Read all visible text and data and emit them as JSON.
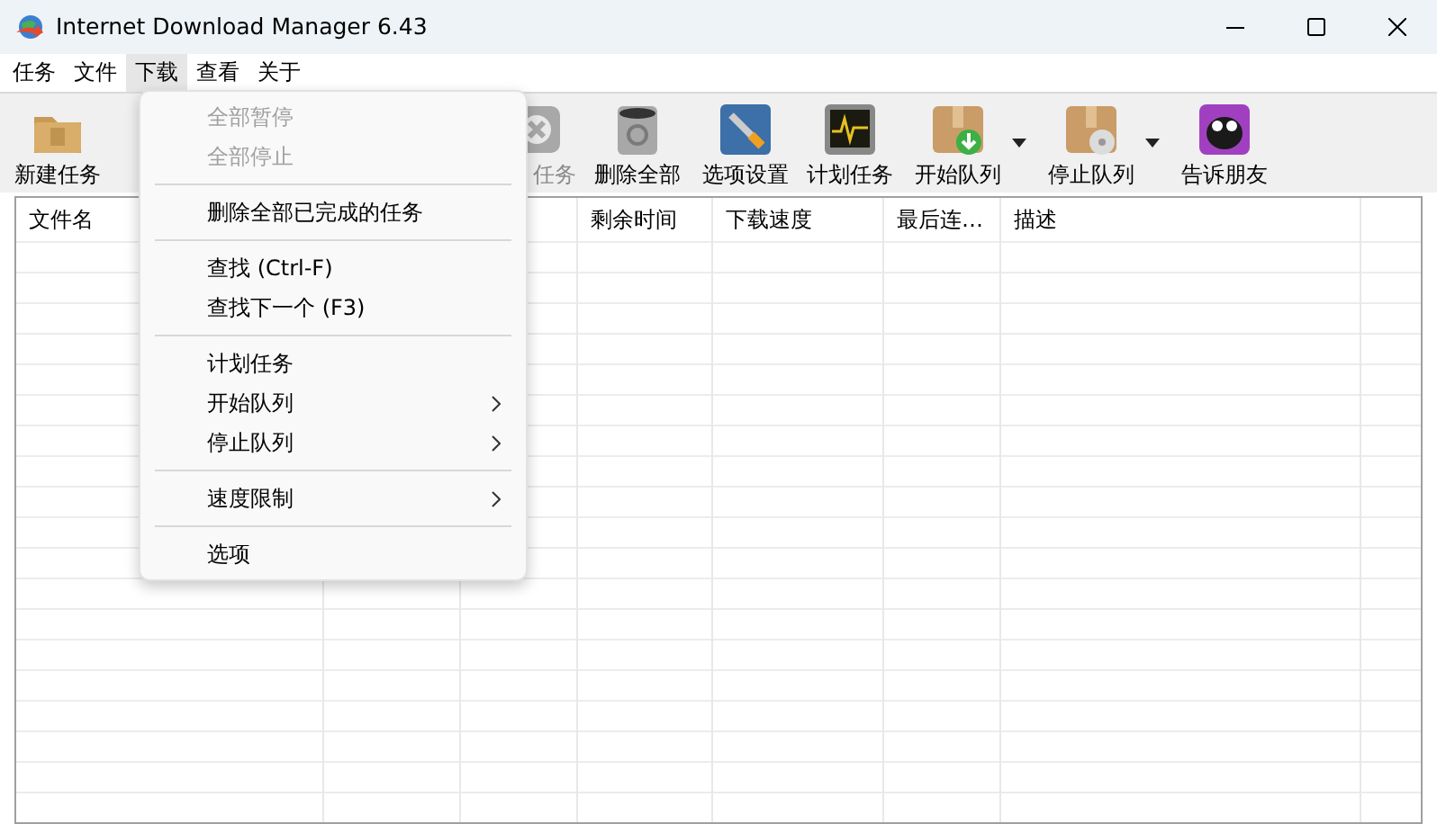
{
  "window": {
    "title": "Internet Download Manager 6.43"
  },
  "menubar": [
    {
      "label": "任务",
      "selected": false
    },
    {
      "label": "文件",
      "selected": false
    },
    {
      "label": "下载",
      "selected": true
    },
    {
      "label": "查看",
      "selected": false
    },
    {
      "label": "关于",
      "selected": false
    }
  ],
  "toolbar": [
    {
      "label": "新建任务",
      "disabled": false,
      "dropdown": false
    },
    {
      "label": "任务",
      "disabled": true,
      "dropdown": false
    },
    {
      "label": "删除全部",
      "disabled": false,
      "dropdown": false
    },
    {
      "label": "选项设置",
      "disabled": false,
      "dropdown": false
    },
    {
      "label": "计划任务",
      "disabled": false,
      "dropdown": false
    },
    {
      "label": "开始队列",
      "disabled": false,
      "dropdown": true
    },
    {
      "label": "停止队列",
      "disabled": false,
      "dropdown": true
    },
    {
      "label": "告诉朋友",
      "disabled": false,
      "dropdown": false
    }
  ],
  "table": {
    "columns": [
      {
        "label": "文件名"
      },
      {},
      {},
      {
        "label": "剩余时间"
      },
      {
        "label": "下载速度"
      },
      {
        "label": "最后连…"
      },
      {
        "label": "描述"
      },
      {}
    ]
  },
  "menu": {
    "items": [
      {
        "kind": "item",
        "label": "全部暂停",
        "disabled": true,
        "submenu": false
      },
      {
        "kind": "item",
        "label": "全部停止",
        "disabled": true,
        "submenu": false
      },
      {
        "kind": "separator"
      },
      {
        "kind": "item",
        "label": "删除全部已完成的任务",
        "disabled": false,
        "submenu": false
      },
      {
        "kind": "separator"
      },
      {
        "kind": "item",
        "label": "查找 (Ctrl-F)",
        "disabled": false,
        "submenu": false
      },
      {
        "kind": "item",
        "label": "查找下一个 (F3)",
        "disabled": false,
        "submenu": false
      },
      {
        "kind": "separator"
      },
      {
        "kind": "item",
        "label": "计划任务",
        "disabled": false,
        "submenu": false
      },
      {
        "kind": "item",
        "label": "开始队列",
        "disabled": false,
        "submenu": true
      },
      {
        "kind": "item",
        "label": "停止队列",
        "disabled": false,
        "submenu": true
      },
      {
        "kind": "separator"
      },
      {
        "kind": "item",
        "label": "速度限制",
        "disabled": false,
        "submenu": true
      },
      {
        "kind": "separator"
      },
      {
        "kind": "item",
        "label": "选项",
        "disabled": false,
        "submenu": false
      }
    ]
  }
}
